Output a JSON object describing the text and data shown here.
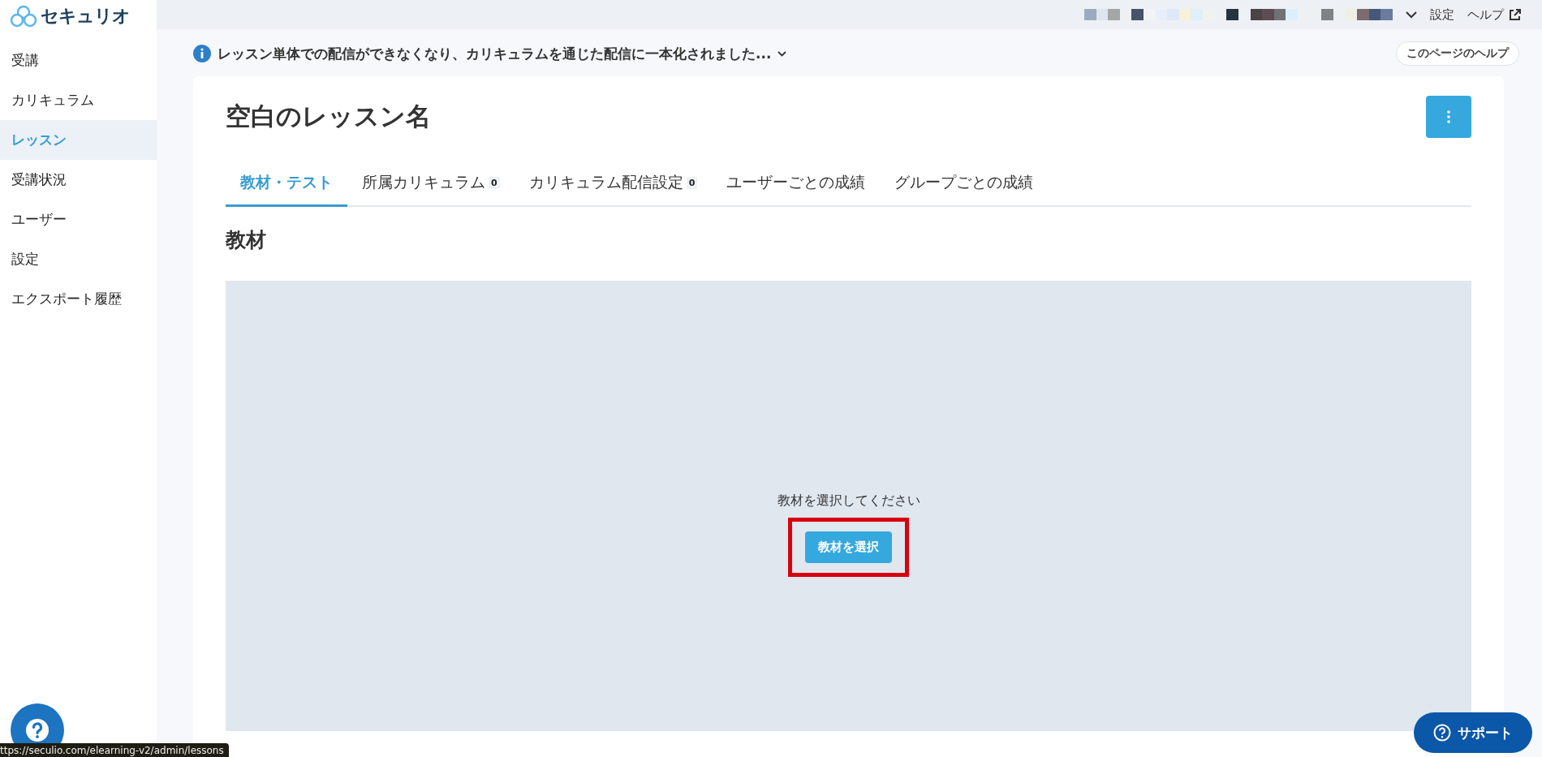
{
  "logo": {
    "text": "セキュリオ"
  },
  "sidebar": {
    "items": [
      {
        "label": "受講",
        "selected": false
      },
      {
        "label": "カリキュラム",
        "selected": false
      },
      {
        "label": "レッスン",
        "selected": true
      },
      {
        "label": "受講状況",
        "selected": false
      },
      {
        "label": "ユーザー",
        "selected": false
      },
      {
        "label": "設定",
        "selected": false
      },
      {
        "label": "エクスポート履歴",
        "selected": false
      }
    ]
  },
  "topbar": {
    "links": [
      {
        "label": "設定",
        "external": false
      },
      {
        "label": "ヘルプ",
        "external": true
      }
    ]
  },
  "notice": {
    "text": "レッスン単体での配信ができなくなり、カリキュラムを通じた配信に一本化されました..."
  },
  "page_help": "このページのヘルプ",
  "title": "空白のレッスン名",
  "tabs": [
    {
      "label": "教材・テスト",
      "selected": true
    },
    {
      "label": "所属カリキュラム",
      "selected": false,
      "count": "0"
    },
    {
      "label": "カリキュラム配信設定",
      "selected": false,
      "count": "0"
    },
    {
      "label": "ユーザーごとの成績",
      "selected": false
    },
    {
      "label": "グループごとの成績",
      "selected": false
    }
  ],
  "section_title": "教材",
  "empty_state": {
    "message": "教材を選択してください",
    "button": "教材を選択",
    "highlighted": true
  },
  "support_button": "サポート",
  "status_url": "ttps://seculio.com/elearning-v2/admin/lessons"
}
